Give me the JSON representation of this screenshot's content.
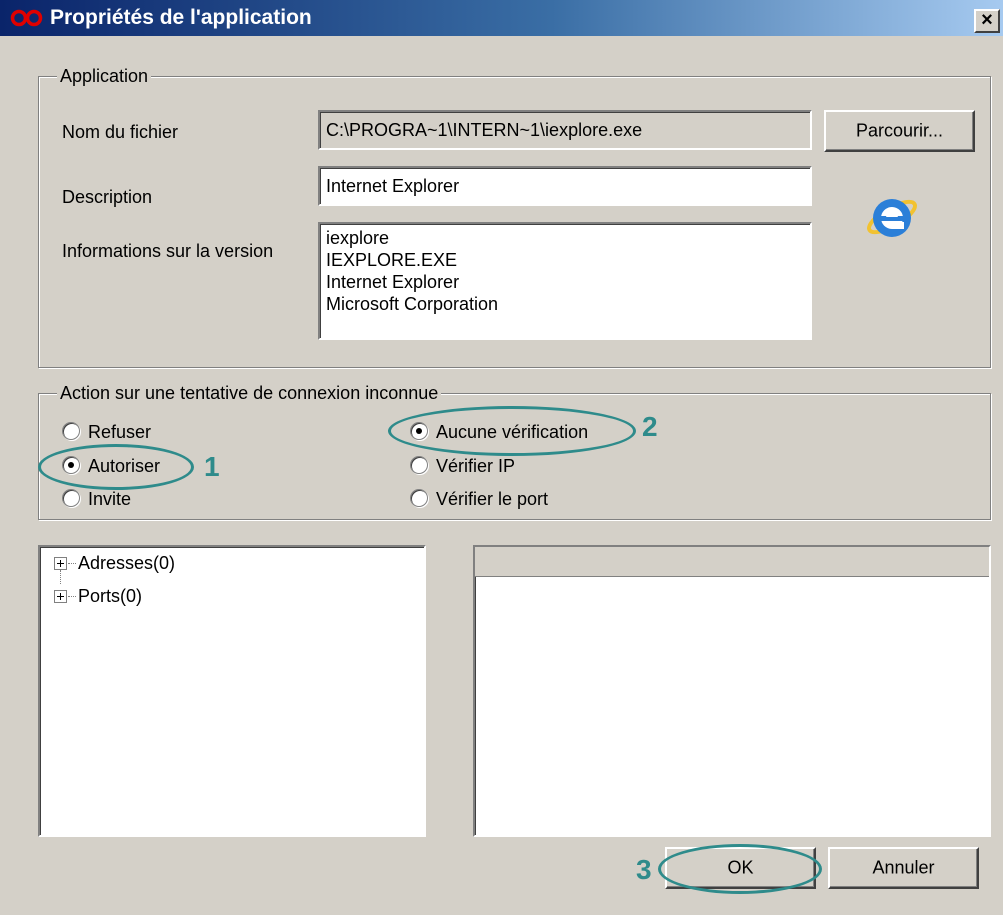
{
  "window": {
    "title": "Propriétés de l'application",
    "close_label": "×"
  },
  "app_group": {
    "legend": "Application",
    "filename_label": "Nom du fichier",
    "filename_value": "C:\\PROGRA~1\\INTERN~1\\iexplore.exe",
    "browse_label": "Parcourir...",
    "description_label": "Description",
    "description_value": "Internet Explorer",
    "version_label": "Informations sur la version",
    "version_lines": [
      "iexplore",
      "IEXPLORE.EXE",
      "Internet Explorer",
      "Microsoft Corporation"
    ],
    "app_icon": "internet-explorer-icon"
  },
  "action_group": {
    "legend": "Action sur une tentative de connexion inconnue",
    "options_left": [
      {
        "label": "Refuser",
        "checked": false
      },
      {
        "label": "Autoriser",
        "checked": true
      },
      {
        "label": "Invite",
        "checked": false
      }
    ],
    "options_right": [
      {
        "label": "Aucune vérification",
        "checked": true
      },
      {
        "label": "Vérifier IP",
        "checked": false
      },
      {
        "label": "Vérifier le port",
        "checked": false
      }
    ]
  },
  "tree": {
    "items": [
      "Adresses(0)",
      "Ports(0)"
    ]
  },
  "buttons": {
    "ok": "OK",
    "cancel": "Annuler"
  },
  "annotations": {
    "n1": "1",
    "n2": "2",
    "n3": "3",
    "color": "#2e8b8b"
  },
  "colors": {
    "dialog_bg": "#d4d0c8",
    "title_start": "#0a246a",
    "title_end": "#a6caf0"
  }
}
